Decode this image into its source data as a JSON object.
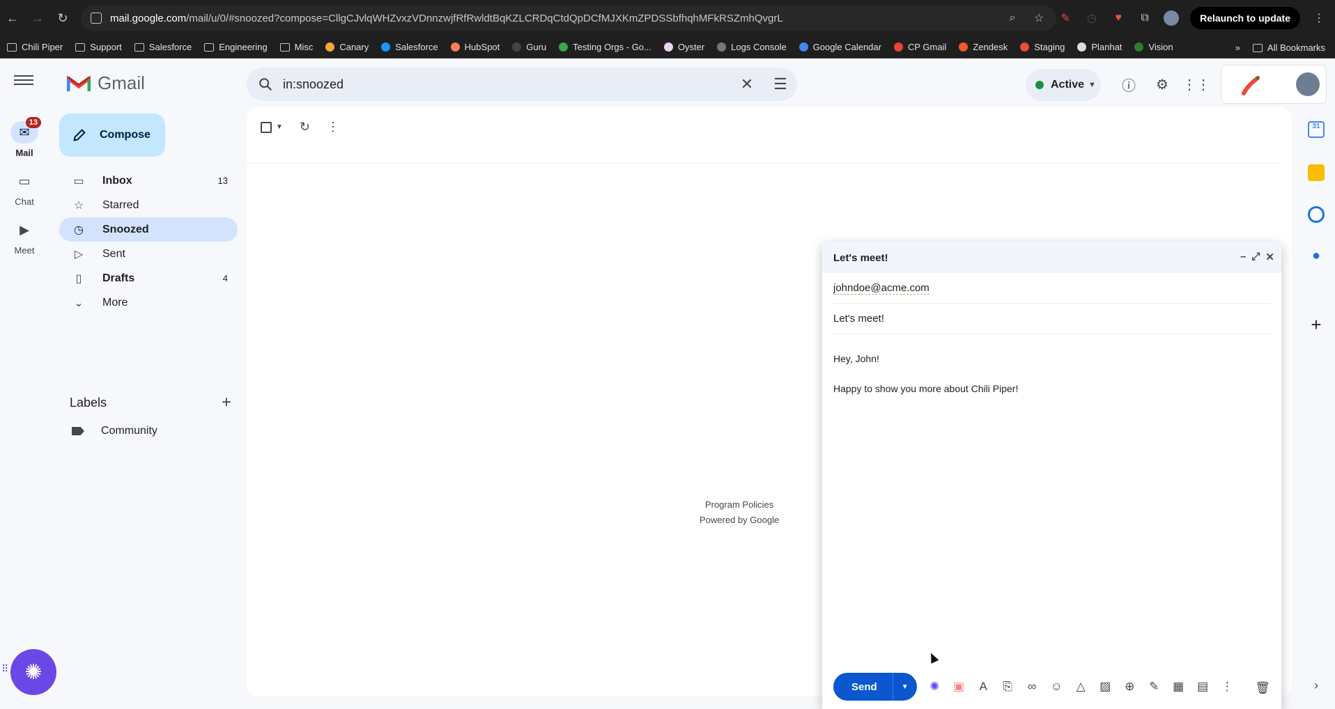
{
  "browser": {
    "url_domain": "mail.google.com",
    "url_path": "/mail/u/0/#snoozed?compose=CllgCJvlqWHZvxzVDnnzwjfRfRwldtBqKZLCRDqCtdQpDCfMJXKmZPDSSbfhqhMFkRSZmhQvgrL",
    "relaunch_label": "Relaunch to update"
  },
  "bookmarks": [
    {
      "label": "Chili Piper",
      "icon": "folder-icon"
    },
    {
      "label": "Support",
      "icon": "folder-icon"
    },
    {
      "label": "Salesforce",
      "icon": "folder-icon"
    },
    {
      "label": "Engineering",
      "icon": "folder-icon"
    },
    {
      "label": "Misc",
      "icon": "folder-icon"
    },
    {
      "label": "Canary",
      "icon": "canary-icon",
      "color": "#f2a93b"
    },
    {
      "label": "Salesforce",
      "icon": "salesforce-icon",
      "color": "#1b96ff"
    },
    {
      "label": "HubSpot",
      "icon": "hubspot-icon",
      "color": "#ff7a59"
    },
    {
      "label": "Guru",
      "icon": "guru-icon",
      "color": "#444444"
    },
    {
      "label": "Testing Orgs - Go...",
      "icon": "sheets-icon",
      "color": "#34a853"
    },
    {
      "label": "Oyster",
      "icon": "oyster-icon",
      "color": "#e8d6f0"
    },
    {
      "label": "Logs Console",
      "icon": "gear-icon",
      "color": "#777777"
    },
    {
      "label": "Google Calendar",
      "icon": "calendar-icon",
      "color": "#4285f4"
    },
    {
      "label": "CP Gmail",
      "icon": "gmail-icon",
      "color": "#ea4335"
    },
    {
      "label": "Zendesk",
      "icon": "zendesk-icon",
      "color": "#f15a24"
    },
    {
      "label": "Staging",
      "icon": "chili-icon",
      "color": "#e94b3c"
    },
    {
      "label": "Planhat",
      "icon": "planhat-icon",
      "color": "#dddddd"
    },
    {
      "label": "Vision",
      "icon": "vision-icon",
      "color": "#2e7d32"
    }
  ],
  "bookmarks_more": "»",
  "all_bookmarks": "All Bookmarks",
  "rail": {
    "mail": {
      "label": "Mail",
      "badge": "13"
    },
    "chat": {
      "label": "Chat"
    },
    "meet": {
      "label": "Meet"
    }
  },
  "app_name": "Gmail",
  "search": {
    "query": "in:snoozed"
  },
  "status": {
    "label": "Active",
    "color": "#1e8e3e"
  },
  "compose_label": "Compose",
  "nav": [
    {
      "label": "Inbox",
      "count": "13",
      "icon": "inbox-icon",
      "bold": true
    },
    {
      "label": "Starred",
      "count": "",
      "icon": "star-icon",
      "bold": false
    },
    {
      "label": "Snoozed",
      "count": "",
      "icon": "clock-icon",
      "bold": true,
      "active": true
    },
    {
      "label": "Sent",
      "count": "",
      "icon": "send-icon",
      "bold": false
    },
    {
      "label": "Drafts",
      "count": "4",
      "icon": "draft-icon",
      "bold": true
    },
    {
      "label": "More",
      "count": "",
      "icon": "chevron-down-icon",
      "bold": false
    }
  ],
  "labels_title": "Labels",
  "labels": [
    {
      "label": "Community"
    }
  ],
  "footer": {
    "program_policies": "Program Policies",
    "powered_by": "Powered by Google"
  },
  "compose_window": {
    "title": "Let's meet!",
    "to": "johndoe@acme.com",
    "subject": "Let's meet!",
    "body_line1": "Hey, John!",
    "body_line2": "Happy to show you more about Chili Piper!",
    "send_label": "Send"
  },
  "colors": {
    "accent": "#0b57d0",
    "compose_bg": "#c2e7ff",
    "active_nav": "#d3e3fd",
    "chili_fab": "#6b47e6"
  }
}
